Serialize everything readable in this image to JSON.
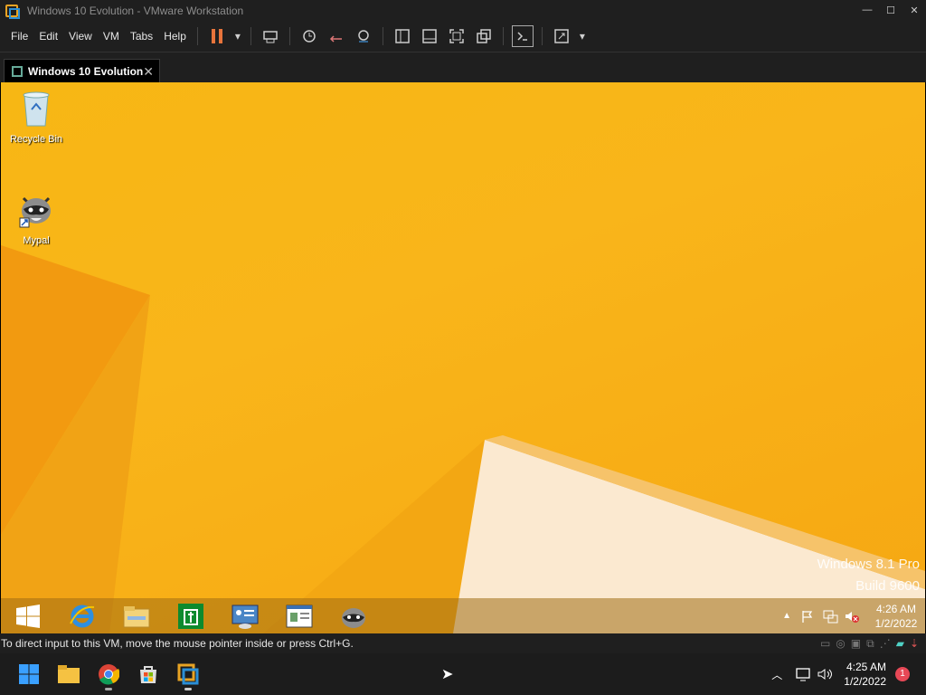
{
  "window": {
    "title": "Windows 10 Evolution - VMware Workstation",
    "minimize": "—",
    "maximize": "☐",
    "close": "✕"
  },
  "menu": [
    "File",
    "Edit",
    "View",
    "VM",
    "Tabs",
    "Help"
  ],
  "tab": {
    "label": "Windows 10 Evolution",
    "close": "✕"
  },
  "desktop": {
    "icons": [
      {
        "label": "Recycle Bin"
      },
      {
        "label": "Mypal"
      }
    ],
    "watermark": {
      "line1": "Windows 8.1 Pro",
      "line2": "Build 9600"
    }
  },
  "vm_taskbar": {
    "time": "4:26 AM",
    "date": "1/2/2022"
  },
  "status": {
    "message": "To direct input to this VM, move the mouse pointer inside or press Ctrl+G."
  },
  "host_taskbar": {
    "time": "4:25 AM",
    "date": "1/2/2022",
    "notification_count": "1"
  },
  "colors": {
    "wallpaper": "#f7b714",
    "accent": "#e8743b"
  }
}
